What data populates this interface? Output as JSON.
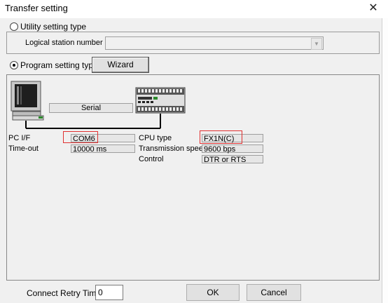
{
  "window": {
    "title": "Transfer setting",
    "close_glyph": "✕"
  },
  "utility": {
    "radio_label": "Utility setting type",
    "checked": false
  },
  "logical_station": {
    "label": "Logical station number",
    "value": ""
  },
  "program": {
    "radio_label": "Program setting type",
    "checked": true,
    "wizard_label": "Wizard"
  },
  "diagram": {
    "connection_label": "Serial",
    "pc": {
      "if_label": "PC I/F",
      "if_value": "COM6",
      "timeout_label": "Time-out",
      "timeout_value": "10000 ms"
    },
    "plc": {
      "cpu_label": "CPU type",
      "cpu_value": "FX1N(C)",
      "speed_label": "Transmission speed",
      "speed_value": "9600 bps",
      "control_label": "Control",
      "control_value": "DTR or RTS"
    },
    "highlight_color": "#e03030"
  },
  "footer": {
    "retry_label": "Connect Retry Times",
    "retry_value": "0",
    "ok_label": "OK",
    "cancel_label": "Cancel"
  },
  "icons": [
    "close-icon",
    "computer-icon",
    "plc-icon",
    "chevron-down-icon"
  ]
}
